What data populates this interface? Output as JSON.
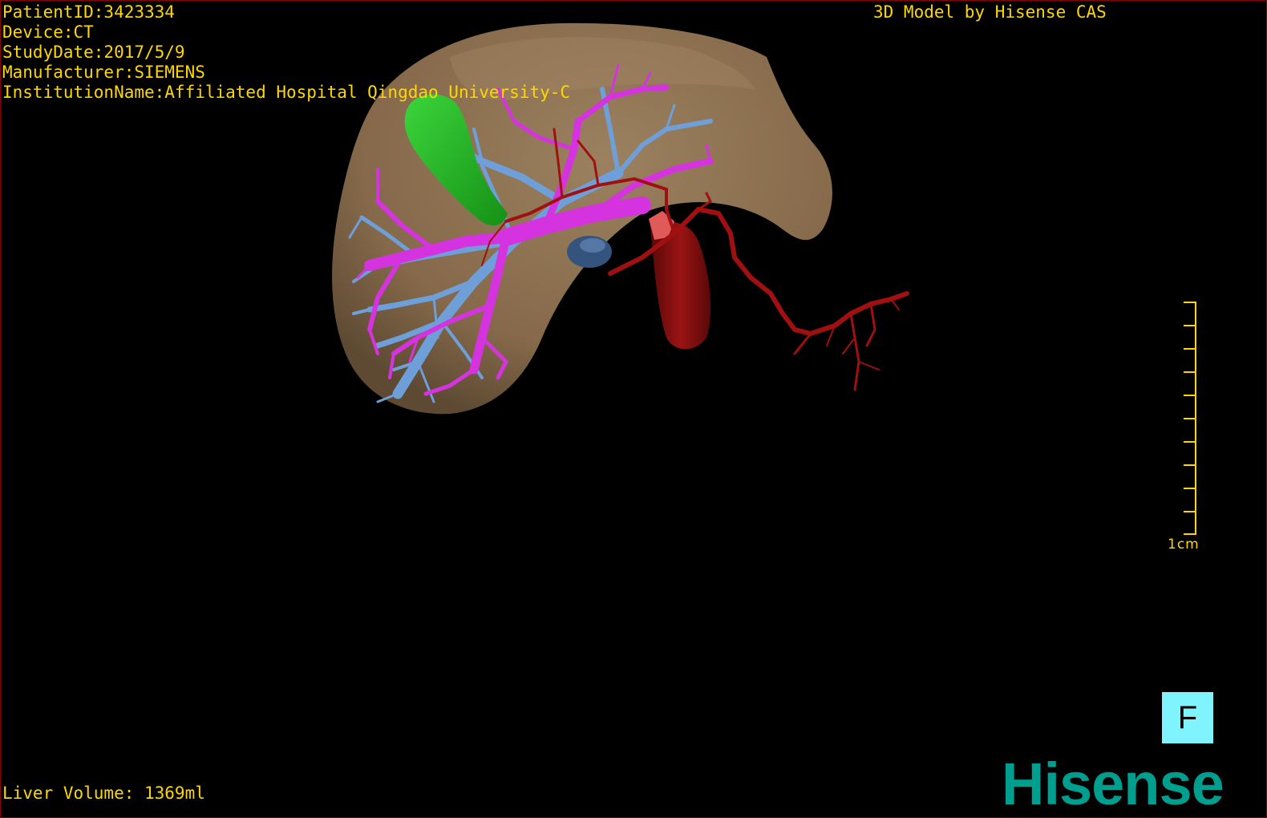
{
  "header": {
    "patient_id": "PatientID:3423334",
    "device": "Device:CT",
    "study_date": "StudyDate:2017/5/9",
    "manufacturer": "Manufacturer:SIEMENS",
    "institution": "InstitutionName:Affiliated Hospital Qingdao University-C"
  },
  "title": "3D Model by Hisense CAS",
  "liver_volume": "Liver Volume: 1369ml",
  "scale_bar": {
    "label": "1cm"
  },
  "orientation": {
    "label": "F"
  },
  "logo": "Hisense",
  "colors": {
    "text": "#ffd700",
    "liver": "#8a7050",
    "portal_vein": "#d633e0",
    "hepatic_vein": "#6f9fd8",
    "artery": "#a01010",
    "gallbladder": "#22b522",
    "orientation_box": "#7ff4ff",
    "logo": "#009e8e"
  }
}
